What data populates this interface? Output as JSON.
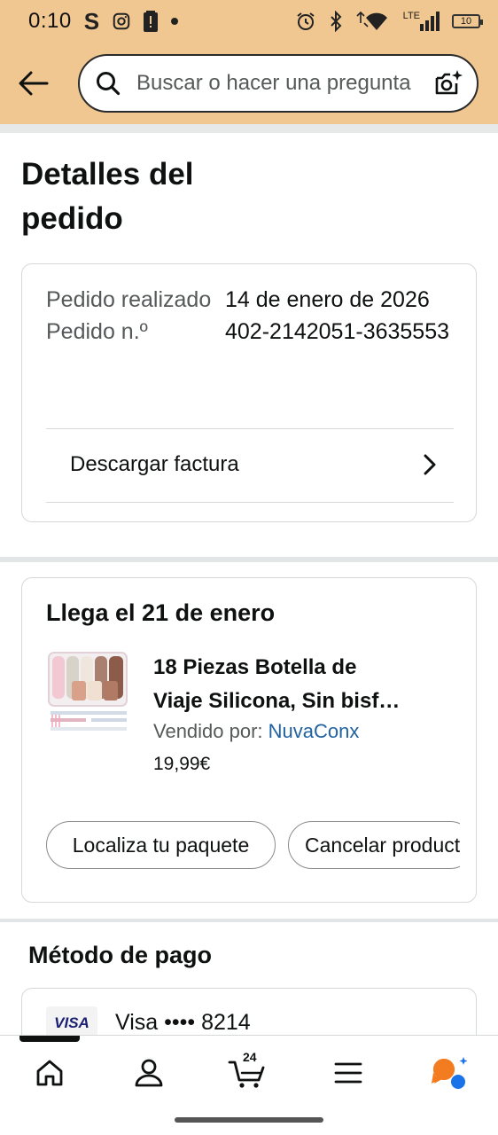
{
  "status_bar": {
    "time": "0:10",
    "battery": "10",
    "network": "LTE"
  },
  "header": {
    "search_placeholder": "Buscar o hacer una pregunta"
  },
  "page": {
    "title": "Detalles del pedido"
  },
  "order": {
    "placed_label": "Pedido realizado",
    "placed_date": "14 de enero de 2026",
    "number_label": "Pedido n.º",
    "number": "402-2142051-3635553",
    "invoice_label": "Descargar factura"
  },
  "shipment": {
    "arrival": "Llega el 21 de enero",
    "product_title_line1": "18 Piezas Botella de",
    "product_title_line2": "Viaje Silicona, Sin bisf…",
    "seller_label": "Vendido por:",
    "seller_name": "NuvaConx",
    "price": "19,99€",
    "track_button": "Localiza tu paquete",
    "cancel_button": "Cancelar producto"
  },
  "payment": {
    "title": "Método de pago",
    "card_brand": "VISA",
    "card_text": "Visa •••• 8214"
  },
  "bottom_nav": {
    "cart_count": "24"
  },
  "colors": {
    "header_bg": "#f0c691",
    "link": "#2162a1",
    "ai_orange": "#f47c20",
    "ai_blue": "#1a73e8"
  },
  "icons": [
    "back-arrow-icon",
    "search-icon",
    "camera-sparkle-icon",
    "chevron-right-icon",
    "home-icon",
    "account-icon",
    "cart-icon",
    "menu-icon",
    "rufus-ai-icon"
  ]
}
